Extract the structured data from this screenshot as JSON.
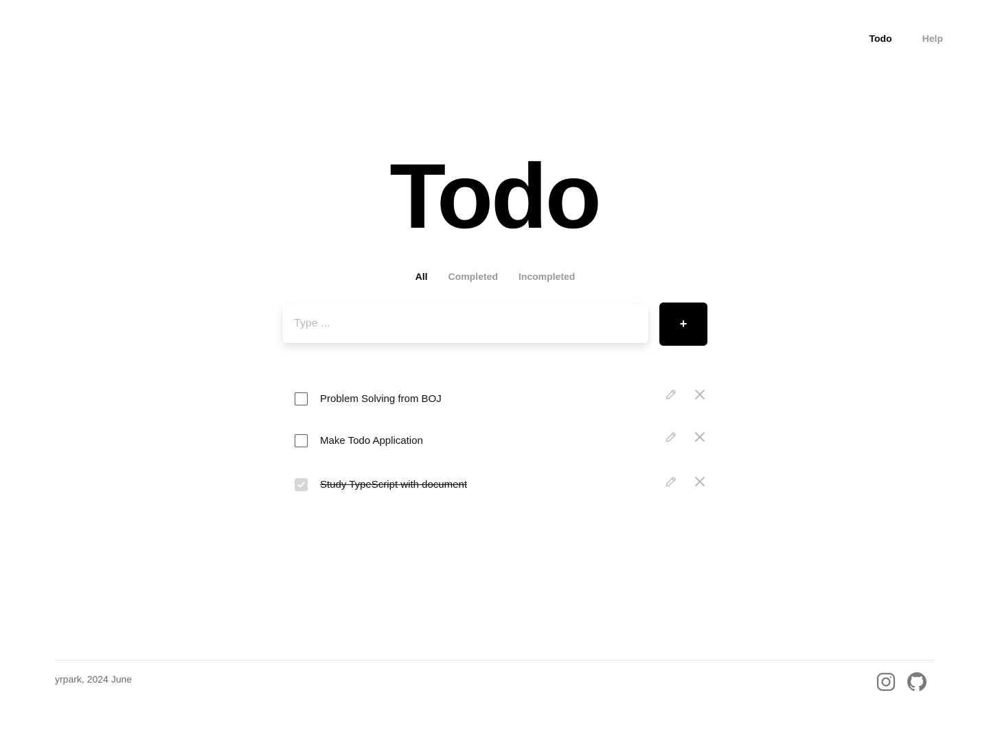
{
  "nav": {
    "items": [
      {
        "label": "Todo",
        "active": true
      },
      {
        "label": "Help",
        "active": false
      }
    ]
  },
  "title": "Todo",
  "filters": {
    "items": [
      {
        "label": "All",
        "active": true
      },
      {
        "label": "Completed",
        "active": false
      },
      {
        "label": "Incompleted",
        "active": false
      }
    ]
  },
  "input": {
    "placeholder": "Type ...",
    "value": ""
  },
  "add_button": {
    "label": "+"
  },
  "todos": [
    {
      "text": "Problem Solving from BOJ",
      "completed": false
    },
    {
      "text": "Make Todo Application",
      "completed": false
    },
    {
      "text": "Study TypeScript with document",
      "completed": true
    }
  ],
  "footer": {
    "text": "yrpark, 2024 June",
    "icons": [
      "instagram-icon",
      "github-icon"
    ]
  },
  "colors": {
    "accent": "#000000",
    "muted": "#9a9a9a",
    "icon_gray": "#b0b0b0"
  }
}
